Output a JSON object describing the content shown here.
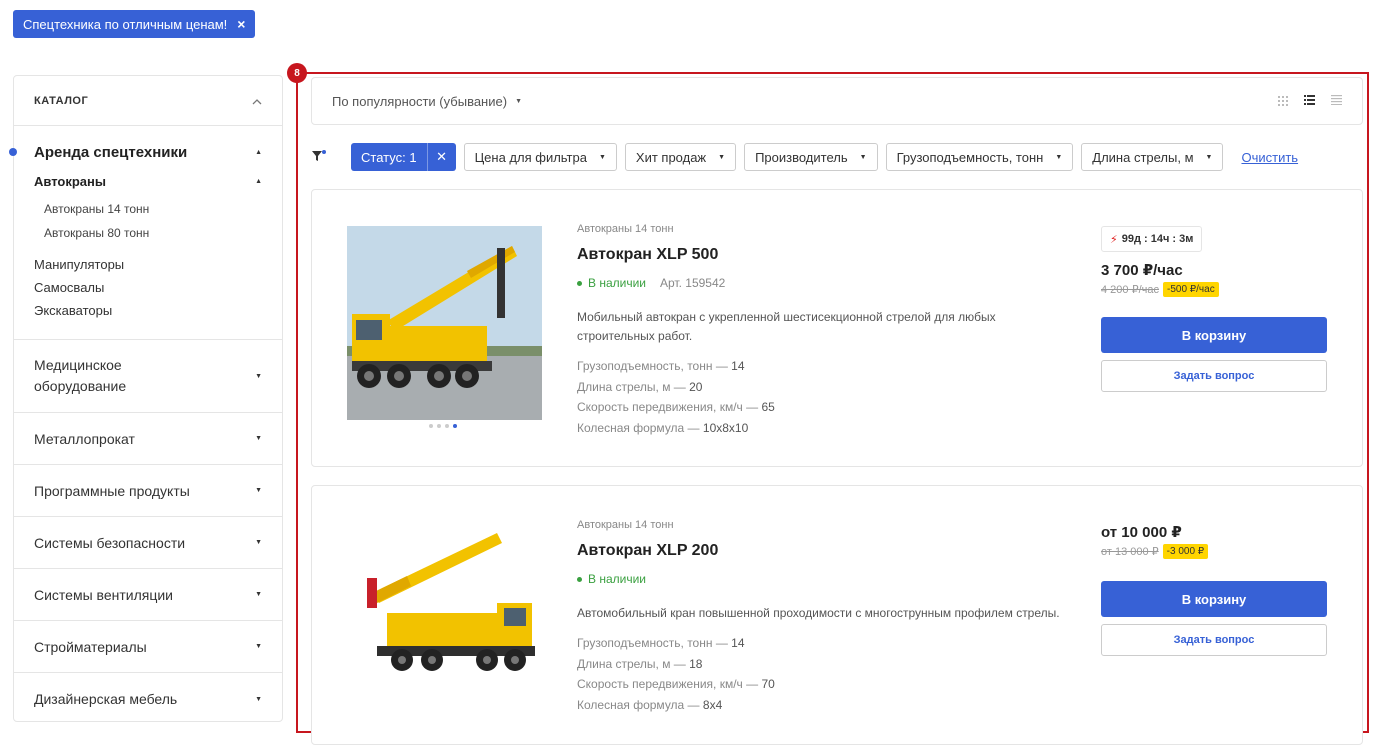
{
  "banner": {
    "text": "Спецтехника по отличным ценам!",
    "close": "×"
  },
  "sidebar": {
    "title": "КАТАЛОГ",
    "active_section": "Аренда спецтехники",
    "active_subsection": "Автокраны",
    "subitems": [
      "Автокраны 14 тонн",
      "Автокраны 80 тонн"
    ],
    "siblings": [
      "Манипуляторы",
      "Самосвалы",
      "Экскаваторы"
    ],
    "categories": [
      "Медицинское оборудование",
      "Металлопрокат",
      "Программные продукты",
      "Системы безопасности",
      "Системы вентиляции",
      "Стройматериалы",
      "Дизайнерская мебель"
    ]
  },
  "highlight_badge": "8",
  "sort": {
    "label": "По популярности (убывание)"
  },
  "filters": {
    "status": "Статус: 1",
    "chips": [
      "Цена для фильтра",
      "Хит продаж",
      "Производитель",
      "Грузоподъемность, тонн",
      "Длина стрелы, м"
    ],
    "clear": "Очистить"
  },
  "products": [
    {
      "category": "Автокраны 14 тонн",
      "title": "Автокран XLP 500",
      "availability": "В наличии",
      "article": "Арт. 159542",
      "description": "Мобильный автокран с укрепленной шестисекционной стрелой для любых строительных работ.",
      "props": [
        {
          "name": "Грузоподъемность, тонн — ",
          "value": "14"
        },
        {
          "name": "Длина стрелы, м — ",
          "value": "20"
        },
        {
          "name": "Скорость передвижения, км/ч — ",
          "value": "65"
        },
        {
          "name": "Колесная формула — ",
          "value": "10х8х10"
        }
      ],
      "timer": "99д : 14ч : 3м",
      "price": "3 700 ₽/час",
      "old_price": "4 200 ₽/час",
      "discount": "-500 ₽/час",
      "cart": "В корзину",
      "ask": "Задать вопрос"
    },
    {
      "category": "Автокраны 14 тонн",
      "title": "Автокран XLP 200",
      "availability": "В наличии",
      "description": "Автомобильный кран повышенной проходимости с многострунным профилем стрелы.",
      "props": [
        {
          "name": "Грузоподъемность, тонн — ",
          "value": "14"
        },
        {
          "name": "Длина стрелы, м — ",
          "value": "18"
        },
        {
          "name": "Скорость передвижения, км/ч — ",
          "value": "70"
        },
        {
          "name": "Колесная формула — ",
          "value": "8x4"
        }
      ],
      "price": "от 10 000 ₽",
      "old_price": "от 13 000 ₽",
      "discount": "-3 000 ₽",
      "cart": "В корзину",
      "ask": "Задать вопрос"
    }
  ],
  "colors": {
    "accent": "#3761d6",
    "highlight": "#c7161e",
    "discount": "#ffd500",
    "available": "#3aa040"
  }
}
